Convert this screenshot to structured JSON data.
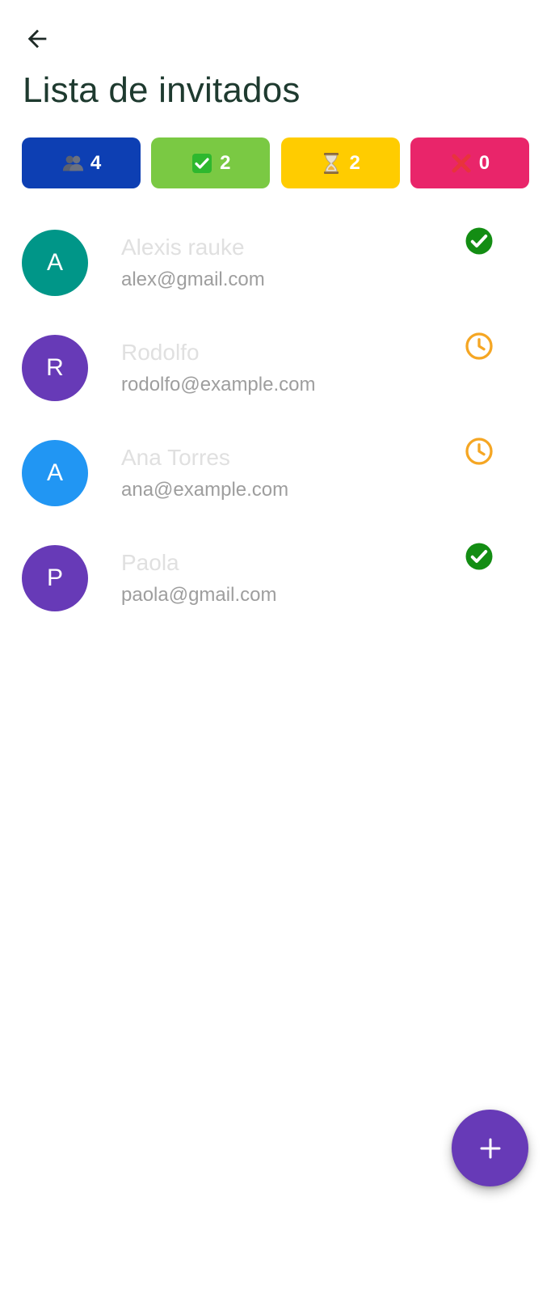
{
  "header": {
    "title": "Lista de invitados",
    "back_icon": "arrow-back-icon"
  },
  "stats": [
    {
      "id": "total",
      "icon": "people-icon",
      "count": "4",
      "color": "#0d3fb3"
    },
    {
      "id": "confirmed",
      "icon": "check-box-icon",
      "count": "2",
      "color": "#7ac943"
    },
    {
      "id": "pending",
      "icon": "hourglass-icon",
      "count": "2",
      "color": "#ffcc00"
    },
    {
      "id": "declined",
      "icon": "cross-mark-icon",
      "count": "0",
      "color": "#e9256a"
    }
  ],
  "guests": [
    {
      "initial": "A",
      "name": "Alexis rauke",
      "email": "alex@gmail.com",
      "avatar_color": "#009688",
      "status": "confirmed",
      "status_icon": "check-circle-icon"
    },
    {
      "initial": "R",
      "name": "Rodolfo",
      "email": "rodolfo@example.com",
      "avatar_color": "#673ab7",
      "status": "pending",
      "status_icon": "clock-icon"
    },
    {
      "initial": "A",
      "name": "Ana Torres",
      "email": "ana@example.com",
      "avatar_color": "#2196f3",
      "status": "pending",
      "status_icon": "clock-icon"
    },
    {
      "initial": "P",
      "name": "Paola",
      "email": "paola@gmail.com",
      "avatar_color": "#673ab7",
      "status": "confirmed",
      "status_icon": "check-circle-icon"
    }
  ],
  "fab": {
    "icon": "plus-icon",
    "color": "#673ab7"
  },
  "status_colors": {
    "confirmed": "#138d13",
    "pending": "#f5a623"
  }
}
